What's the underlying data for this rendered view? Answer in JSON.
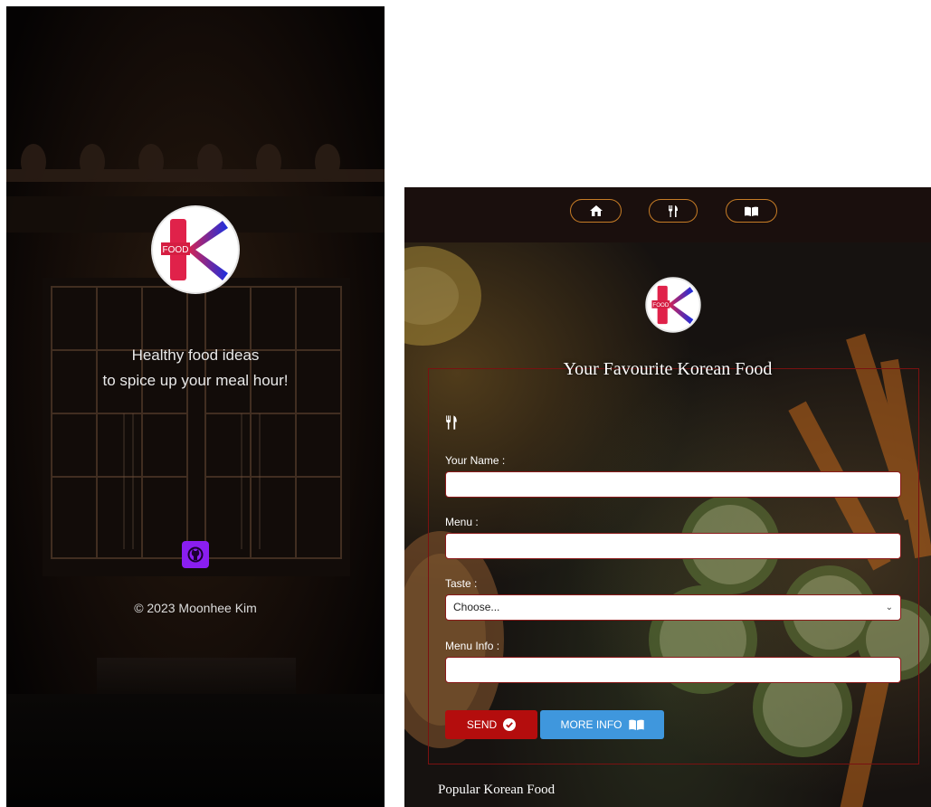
{
  "left_screen": {
    "logo_text": "FOOD",
    "tagline_line1": "Healthy food ideas",
    "tagline_line2": "to spice up your meal hour!",
    "github_icon": "github-icon",
    "copyright": "© 2023 Moonhee Kim"
  },
  "right_screen": {
    "nav": {
      "items": [
        {
          "icon": "home-icon"
        },
        {
          "icon": "utensils-icon"
        },
        {
          "icon": "book-icon"
        }
      ],
      "accent": "#c67c26"
    },
    "logo_text": "FOOD",
    "form": {
      "title": "Your Favourite Korean Food",
      "section_icon": "utensils-icon",
      "name_label": "Your Name :",
      "name_value": "",
      "menu_label": "Menu :",
      "menu_value": "",
      "taste_label": "Taste :",
      "taste_selected": "Choose...",
      "menu_info_label": "Menu Info :",
      "menu_info_value": "",
      "send_label": "SEND",
      "more_info_label": "MORE INFO"
    },
    "popular_heading": "Popular Korean Food"
  },
  "colors": {
    "send_button": "#b40d0d",
    "more_info_button": "#3f97dd",
    "github_button": "#8a1ef0",
    "fieldset_border": "#7a1111"
  }
}
